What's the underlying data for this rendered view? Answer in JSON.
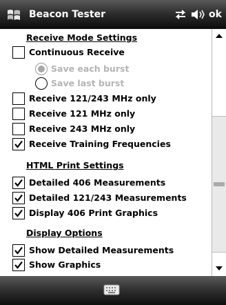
{
  "titlebar": {
    "app_title": "Beacon Tester",
    "ok_label": "ok",
    "icons": [
      "windows-start-icon",
      "connectivity-icon",
      "volume-icon"
    ]
  },
  "receive_mode": {
    "header": "Receive Mode Settings",
    "continuous_receive": {
      "label": "Continuous Receive",
      "checked": false
    },
    "save_each_burst": {
      "label": "Save each burst",
      "selected": true,
      "enabled": false
    },
    "save_last_burst": {
      "label": "Save last burst",
      "selected": false,
      "enabled": false
    },
    "receive_121_243_only": {
      "label": "Receive 121/243 MHz only",
      "checked": false
    },
    "receive_121_only": {
      "label": "Receive 121 MHz only",
      "checked": false
    },
    "receive_243_only": {
      "label": "Receive 243 MHz only",
      "checked": false
    },
    "receive_training": {
      "label": "Receive Training Frequencies",
      "checked": true
    }
  },
  "html_print": {
    "header": "HTML Print Settings",
    "detailed_406": {
      "label": "Detailed 406 Measurements",
      "checked": true
    },
    "detailed_121_243": {
      "label": "Detailed 121/243 Measurements",
      "checked": true
    },
    "display_406_graphics": {
      "label": "Display 406 Print Graphics",
      "checked": true
    }
  },
  "display_options": {
    "header": "Display Options",
    "show_detailed": {
      "label": "Show Detailed Measurements",
      "checked": true
    },
    "show_graphics": {
      "label": "Show Graphics",
      "checked": true
    }
  },
  "scrollbar": {
    "position_fraction": 0.38
  },
  "softkeys": {
    "center_icon": "keyboard-icon"
  },
  "colors": {
    "bar_dark": "#0c0c0c",
    "bar_light": "#5a5a5a",
    "disabled_text": "#b4b4b4",
    "text": "#000000"
  }
}
